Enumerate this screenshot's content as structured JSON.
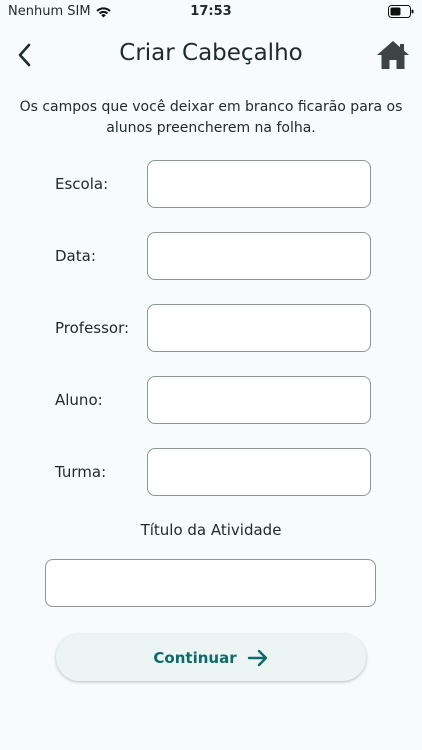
{
  "status_bar": {
    "carrier": "Nenhum SIM",
    "time": "17:53"
  },
  "header": {
    "title": "Criar Cabeçalho",
    "back_icon": "chevron-left-icon",
    "home_icon": "home-icon"
  },
  "instructions": "Os campos que você deixar em branco ficarão para os alunos preencherem na folha.",
  "fields": [
    {
      "label": "Escola:",
      "value": ""
    },
    {
      "label": "Data:",
      "value": ""
    },
    {
      "label": "Professor:",
      "value": ""
    },
    {
      "label": "Aluno:",
      "value": ""
    },
    {
      "label": "Turma:",
      "value": ""
    }
  ],
  "activity": {
    "label": "Título da Atividade",
    "value": ""
  },
  "continue_button": {
    "label": "Continuar",
    "icon": "arrow-right-icon"
  },
  "colors": {
    "background": "#f7fbfb",
    "accent": "#0e6b6b",
    "button_bg": "#edf5f4",
    "input_border": "#8e9595"
  }
}
